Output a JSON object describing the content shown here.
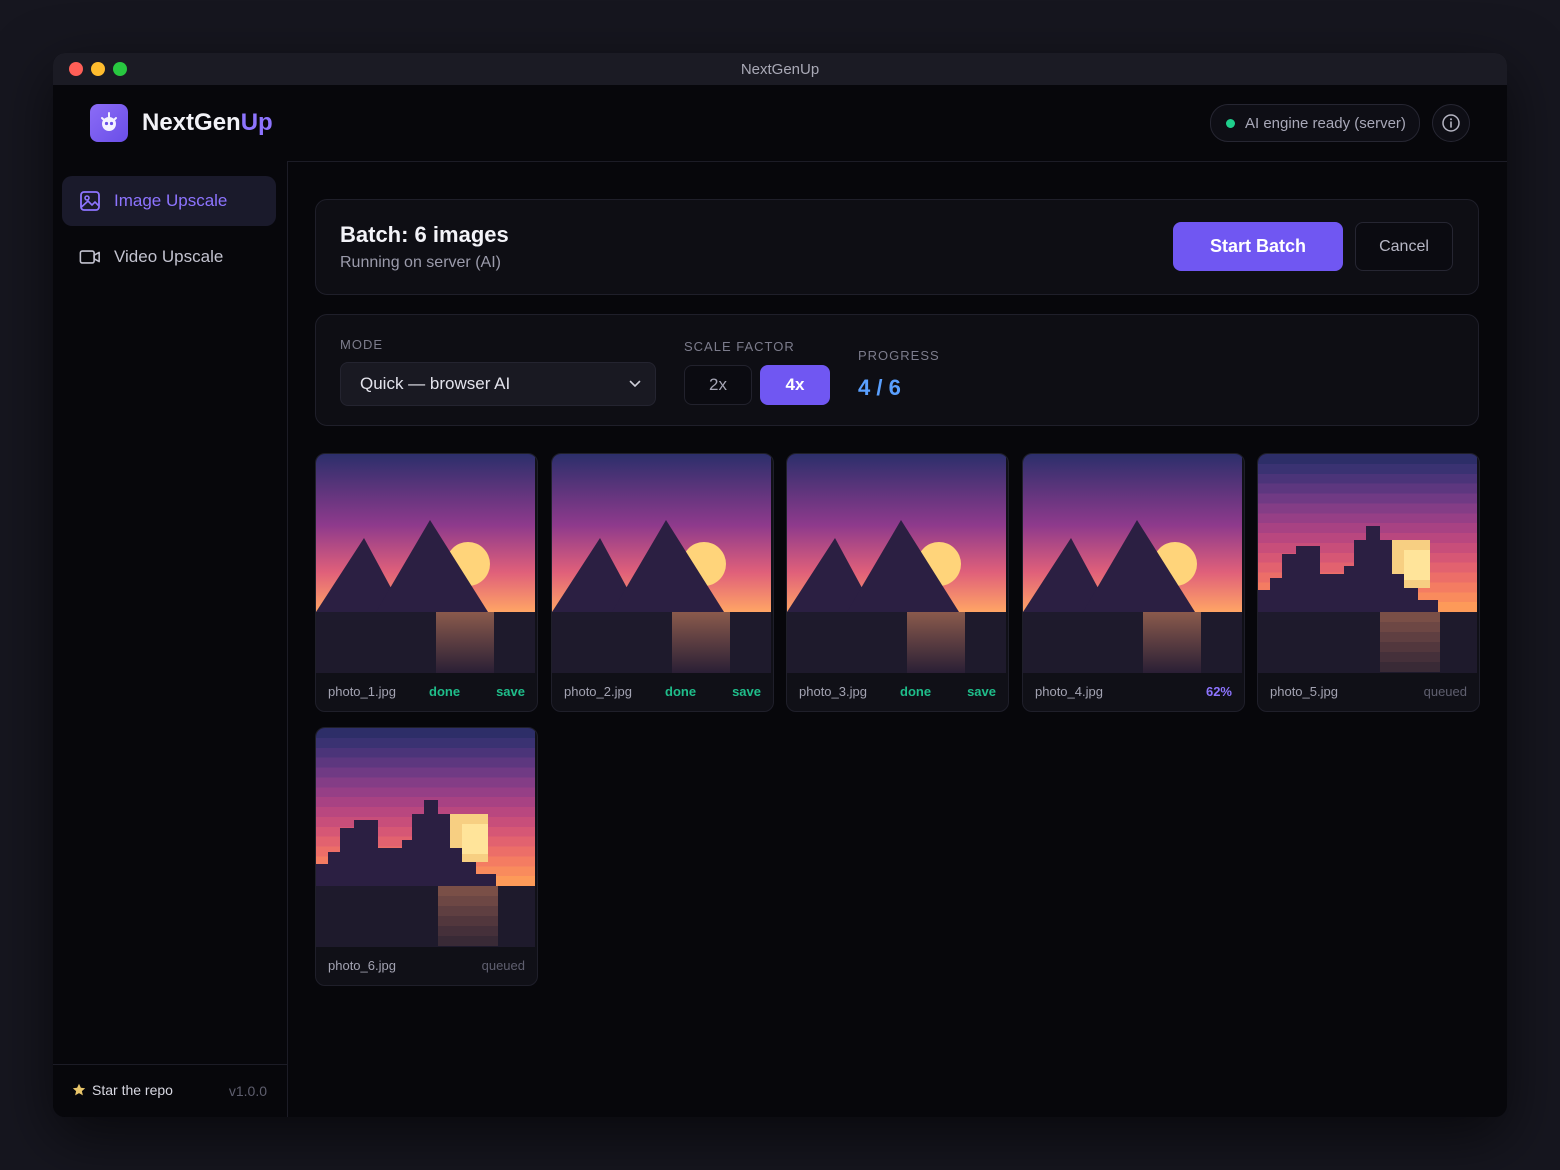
{
  "window": {
    "title": "NextGenUp"
  },
  "brand": {
    "name_main": "NextGen",
    "name_accent": "Up"
  },
  "status": {
    "label": "AI engine ready (server)",
    "color": "#1fcf8c"
  },
  "sidebar": {
    "items": [
      {
        "label": "Image Upscale",
        "icon": "image-icon",
        "active": true
      },
      {
        "label": "Video Upscale",
        "icon": "video-camera-icon",
        "active": false
      }
    ],
    "footer": {
      "star_label": "Star the repo",
      "version": "v1.0.0"
    }
  },
  "batch": {
    "title": "Batch: 6 images",
    "subtitle": "Running on server (AI)",
    "start_label": "Start Batch",
    "cancel_label": "Cancel"
  },
  "controls": {
    "mode_label": "MODE",
    "mode_value": "Quick — browser AI",
    "scale_label": "SCALE FACTOR",
    "scale_options": [
      "2x",
      "4x"
    ],
    "scale_selected": "4x",
    "progress_label": "PROGRESS",
    "progress_value": "4 / 6"
  },
  "images": [
    {
      "name": "photo_1.jpg",
      "status": "done",
      "action": "save",
      "style": "smooth"
    },
    {
      "name": "photo_2.jpg",
      "status": "done",
      "action": "save",
      "style": "smooth"
    },
    {
      "name": "photo_3.jpg",
      "status": "done",
      "action": "save",
      "style": "smooth"
    },
    {
      "name": "photo_4.jpg",
      "status": "62%",
      "action": "",
      "style": "smooth"
    },
    {
      "name": "photo_5.jpg",
      "status": "queued",
      "action": "",
      "style": "pixel"
    },
    {
      "name": "photo_6.jpg",
      "status": "queued",
      "action": "",
      "style": "pixel"
    }
  ],
  "colors": {
    "accent": "#7057f2",
    "done": "#1fbd8a",
    "progress": "#5aa0ff"
  }
}
